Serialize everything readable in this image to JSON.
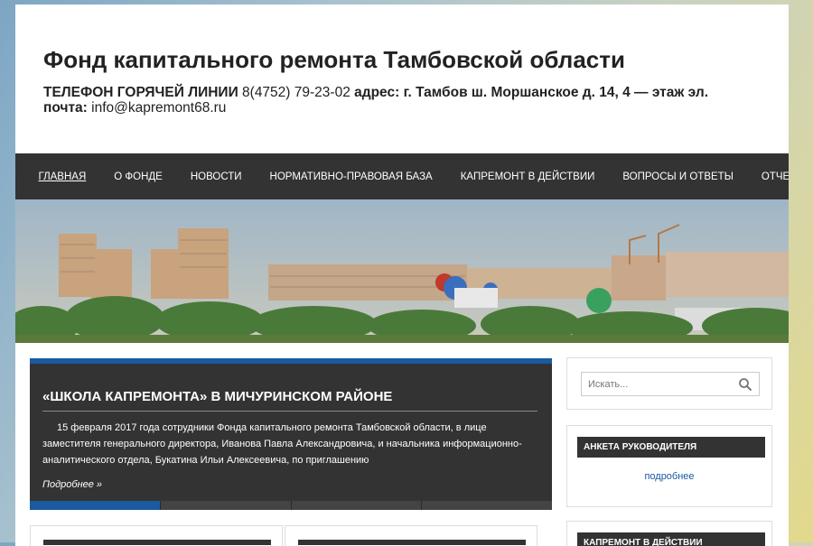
{
  "header": {
    "site_title": "Фонд капитального ремонта Тамбовской области",
    "hotline_label": "ТЕЛЕФОН ГОРЯЧЕЙ ЛИНИИ",
    "hotline_number": "8(4752) 79-23-02",
    "address_label": "адрес:",
    "address_value": "г. Тамбов ш. Моршанское д. 14, 4 — этаж эл. почта:",
    "email": "info@kapremont68.ru"
  },
  "nav": {
    "items": [
      {
        "label": "Главная",
        "active": true
      },
      {
        "label": "О фонде"
      },
      {
        "label": "Новости"
      },
      {
        "label": "Нормативно-правовая база"
      },
      {
        "label": "Капремонт в действии"
      },
      {
        "label": "Вопросы и ответы"
      },
      {
        "label": "Отчеты"
      }
    ]
  },
  "slider": {
    "title": "«Школа капремонта» в Мичуринском районе",
    "text": "15 февраля 2017 года сотрудники Фонда капитального ремонта Тамбовской области, в лице заместителя генерального директора, Иванова Павла Александровича, и начальника информационно-аналитического отдела, Букатина Ильи Алексеевича, по приглашению",
    "more_label": "Подробнее »",
    "active_dot": 0,
    "dot_count": 4
  },
  "sidebar": {
    "search_placeholder": "Искать...",
    "widget1_title": "Анкета руководителя",
    "widget1_link": "подробнее",
    "widget2_title": "Капремонт в действии"
  },
  "colors": {
    "accent": "#1a5aa0",
    "dark": "#333333"
  }
}
